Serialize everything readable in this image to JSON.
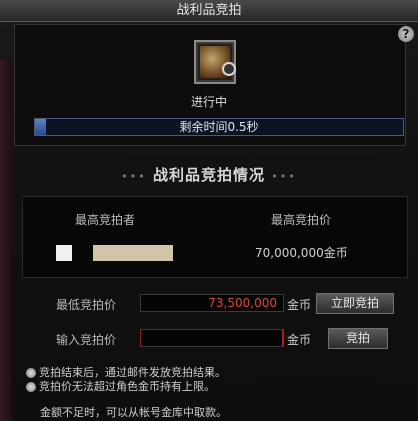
{
  "window": {
    "title": "战利品竞拍",
    "help_label": "?"
  },
  "item": {
    "icon": "loot-item-icon",
    "status": "进行中"
  },
  "timer": {
    "label": "剩余时间0.5秒",
    "remaining_fraction": 0.03
  },
  "section": {
    "title": "战利品竞拍情况",
    "left_dots": "•••",
    "right_dots": "•••"
  },
  "bid_table": {
    "col_bidder": "最高竞拍者",
    "col_price": "最高竞拍价",
    "top_price": "70,000,000金币"
  },
  "form": {
    "min_bid_label": "最低竞拍价",
    "min_bid_value": "73,500,000",
    "min_bid_unit": "金币",
    "instant_bid_label": "立即竞拍",
    "input_label": "输入竞拍价",
    "input_value": "",
    "input_unit": "金币",
    "bid_button_label": "竞拍"
  },
  "notes": [
    "竞拍结束后，通过邮件发放竞拍结果。",
    "竞拍价无法超过角色金币持有上限。"
  ],
  "note_cut": "金额不足时，可以从帐号金库中取款。",
  "colors": {
    "min_price": "#e34040",
    "timer_fill": "#5a84c8"
  }
}
